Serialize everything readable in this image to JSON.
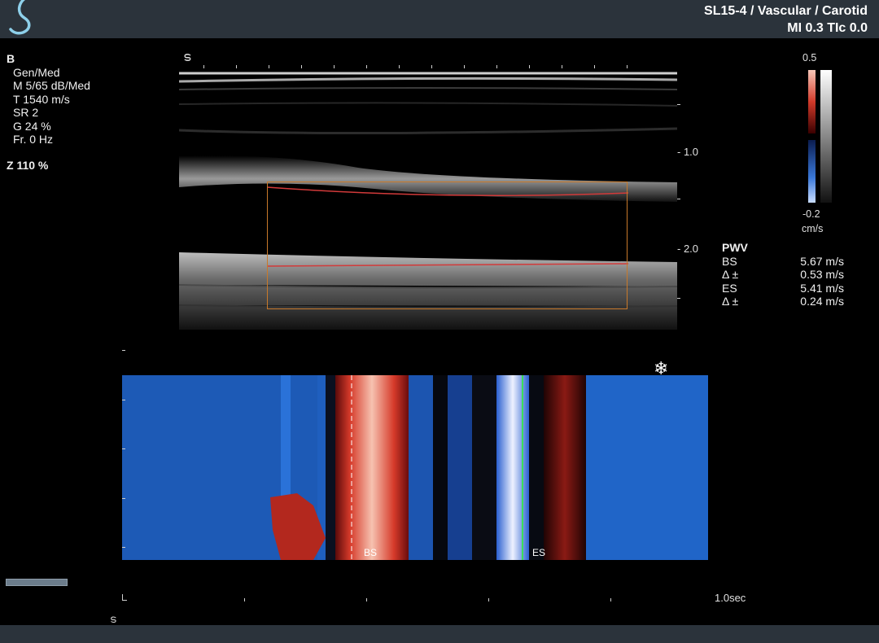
{
  "header": {
    "title": "SL15-4 / Vascular / Carotid",
    "indices": "MI 0.3  TIc  0.0"
  },
  "imaging_params": {
    "mode": "B",
    "lines": [
      "Gen/Med",
      "M 5/65 dB/Med",
      "T 1540 m/s",
      "SR 2",
      "G 24 %",
      "Fr. 0 Hz"
    ],
    "zoom": "Z  110  %"
  },
  "depth_scale": {
    "mark1": "- 1.0",
    "mark2": "- 2.0"
  },
  "color_scale": {
    "max": "0.5",
    "min": "-0.2",
    "unit": "cm/s"
  },
  "pwv": {
    "title": "PWV",
    "rows": [
      {
        "label": "BS",
        "value": "5.67 m/s"
      },
      {
        "label": "Δ ±",
        "value": "0.53 m/s"
      },
      {
        "label": "ES",
        "value": "5.41 m/s"
      },
      {
        "label": "Δ ±",
        "value": "0.24 m/s"
      }
    ]
  },
  "mmode": {
    "marker_bs": "BS",
    "marker_es": "ES",
    "time_label": "1.0sec"
  },
  "progress": {
    "fraction": 0.0
  },
  "colors": {
    "accent_blue": "#8ed0ea",
    "roi_orange": "#c8792a",
    "bar_bg": "#2b333b"
  }
}
